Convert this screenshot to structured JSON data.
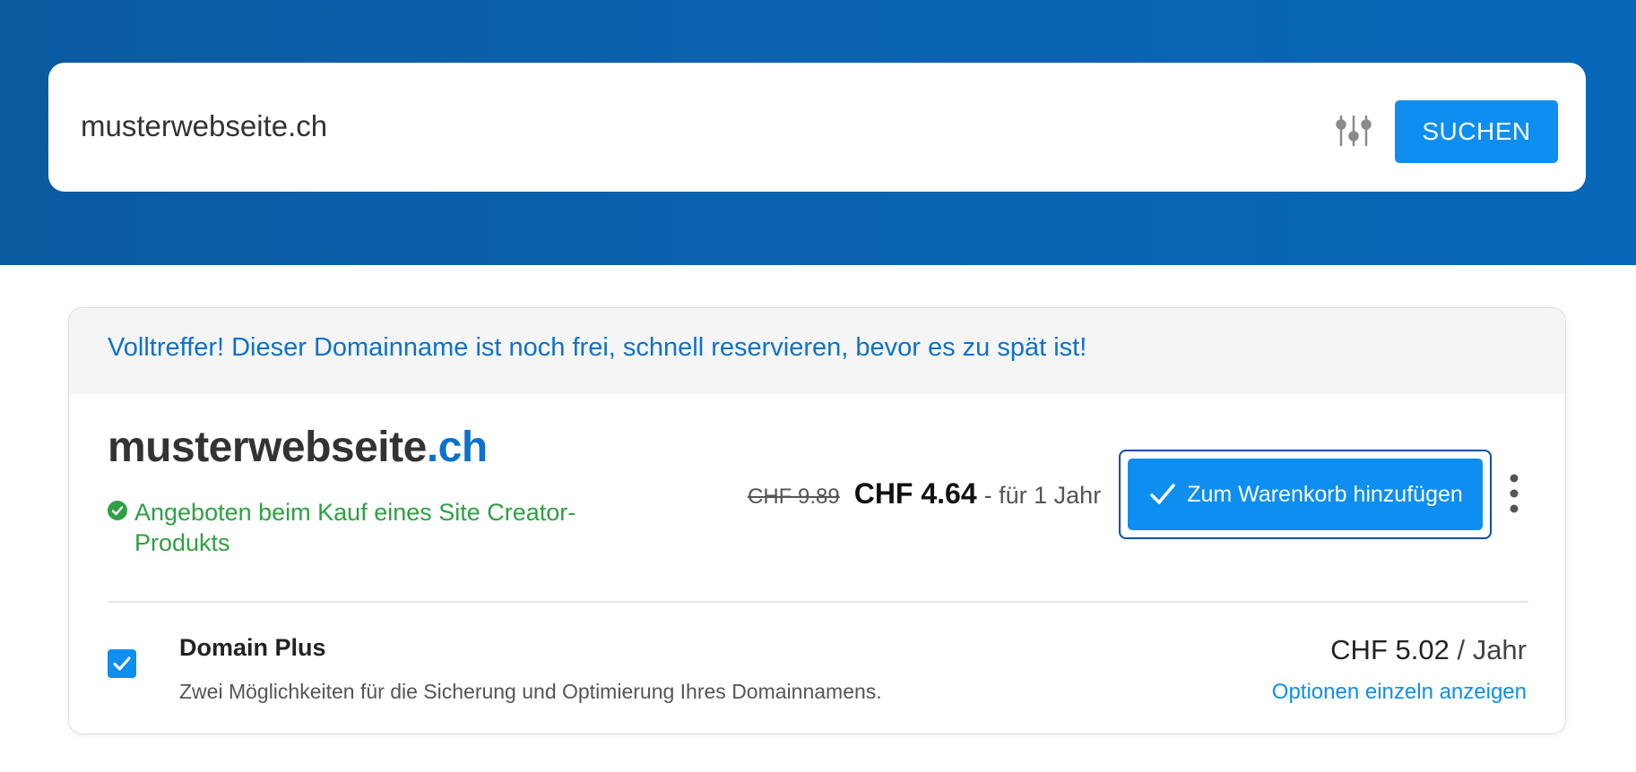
{
  "search": {
    "value": "musterwebseite.ch",
    "filter_icon": "sliders-icon",
    "button_label": "SUCHEN"
  },
  "result": {
    "banner": "Volltreffer! Dieser Domainname ist noch frei, schnell reservieren, bevor es zu spät ist!",
    "domain_base": "musterwebseite",
    "domain_tld": ".ch",
    "offer_icon": "check-circle-icon",
    "offer_text": "Angeboten beim Kauf eines Site Creator-Produkts",
    "old_price": "CHF 9.89",
    "new_price": "CHF 4.64",
    "price_suffix": "- für 1 Jahr",
    "cart_button_label": "Zum Warenkorb hinzufügen",
    "more_icon": "kebab-menu-icon"
  },
  "addon": {
    "checked": true,
    "title": "Domain Plus",
    "description": "Zwei Möglichkeiten für die Sicherung und Optimierung Ihres Domainnamens.",
    "price": "CHF 5.02",
    "price_unit": "/ Jahr",
    "link_label": "Optionen einzeln anzeigen"
  },
  "colors": {
    "header_blue": "#0b63b0",
    "accent_blue": "#0d8ef0",
    "link_blue": "#0d72c9",
    "success_green": "#2ea043"
  }
}
